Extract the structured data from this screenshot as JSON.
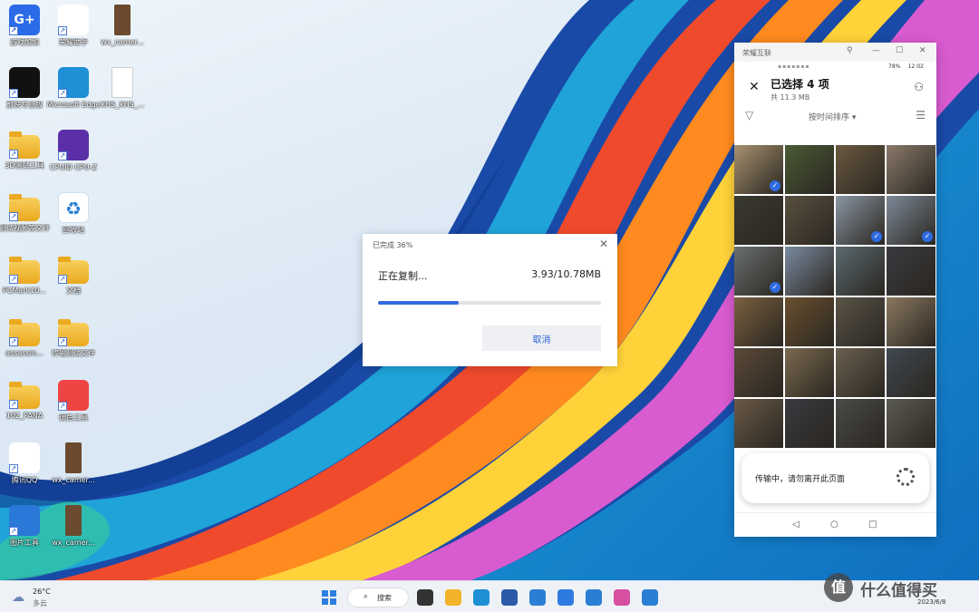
{
  "desktop": {
    "icons": [
      {
        "label": "游戏加加",
        "kind": "app",
        "color": "#2b6be8",
        "text": "G+"
      },
      {
        "label": "荣耀助手",
        "kind": "app",
        "color": "#ffffff",
        "text": ""
      },
      {
        "label": "wx_camer...",
        "kind": "image",
        "color": "#6b4a2f",
        "text": ""
      },
      {
        "label": "剪映专业版",
        "kind": "app",
        "color": "#111111",
        "text": ""
      },
      {
        "label": "Microsoft Edge",
        "kind": "app",
        "color": "#1f8fd6",
        "text": ""
      },
      {
        "label": "XHS_XHS_...",
        "kind": "file",
        "color": "#ffffff",
        "text": ""
      },
      {
        "label": "3D测试工具",
        "kind": "folder",
        "color": "#f0b830",
        "text": ""
      },
      {
        "label": "CPUID CPU-Z",
        "kind": "app",
        "color": "#5b2fa8",
        "text": ""
      },
      {
        "label": "",
        "kind": "none",
        "color": "",
        "text": ""
      },
      {
        "label": "测试视频等文件",
        "kind": "folder",
        "color": "#f0b830",
        "text": ""
      },
      {
        "label": "回收站",
        "kind": "recycle",
        "color": "#ffffff",
        "text": ""
      },
      {
        "label": "",
        "kind": "none",
        "color": "",
        "text": ""
      },
      {
        "label": "PCMark10...",
        "kind": "folder",
        "color": "#f0b830",
        "text": ""
      },
      {
        "label": "文档",
        "kind": "folder",
        "color": "#f0b830",
        "text": ""
      },
      {
        "label": "",
        "kind": "none",
        "color": "",
        "text": ""
      },
      {
        "label": "assassin...",
        "kind": "folder",
        "color": "#f0b830",
        "text": ""
      },
      {
        "label": "传输测试文件",
        "kind": "folder",
        "color": "#f0b830",
        "text": ""
      },
      {
        "label": "",
        "kind": "none",
        "color": "",
        "text": ""
      },
      {
        "label": "102_PANA",
        "kind": "folder",
        "color": "#f0b830",
        "text": ""
      },
      {
        "label": "调色工具",
        "kind": "app",
        "color": "#e44",
        "text": ""
      },
      {
        "label": "",
        "kind": "none",
        "color": "",
        "text": ""
      },
      {
        "label": "腾讯QQ",
        "kind": "app",
        "color": "#ffffff",
        "text": ""
      },
      {
        "label": "wx_camer...",
        "kind": "image",
        "color": "#6b4a2f",
        "text": ""
      },
      {
        "label": "",
        "kind": "none",
        "color": "",
        "text": ""
      },
      {
        "label": "图片工具",
        "kind": "app",
        "color": "#2a78d8",
        "text": ""
      },
      {
        "label": "wx_camer...",
        "kind": "image",
        "color": "#6b4a2f",
        "text": ""
      }
    ]
  },
  "copy_dialog": {
    "title": "已完成 36%",
    "close_glyph": "✕",
    "status": "正在复制...",
    "size": "3.93/10.78MB",
    "progress": 0.36,
    "cancel_label": "取消"
  },
  "phone_window": {
    "title": "荣耀互联",
    "status_time": "12:02",
    "battery": "78%",
    "header": {
      "close_glyph": "✕",
      "selected": "已选择 4 项",
      "total_size": "共 11.3 MB"
    },
    "sort_label": "按时间排序 ▾",
    "photos": [
      {
        "color": "#a89270",
        "checked": true
      },
      {
        "color": "#4a5a35",
        "checked": false
      },
      {
        "color": "#6a5a40",
        "checked": false
      },
      {
        "color": "#8a7a6a",
        "checked": false
      },
      {
        "color": "#3a3a30",
        "checked": false
      },
      {
        "color": "#5a5040",
        "checked": false
      },
      {
        "color": "#8a96a4",
        "checked": true
      },
      {
        "color": "#7e8a98",
        "checked": true
      },
      {
        "color": "#6a7070",
        "checked": true
      },
      {
        "color": "#7a8aa0",
        "checked": false
      },
      {
        "color": "#5a6a70",
        "checked": false
      },
      {
        "color": "#3a3a40",
        "checked": false
      },
      {
        "color": "#7a6040",
        "checked": false
      },
      {
        "color": "#6a5030",
        "checked": false
      },
      {
        "color": "#5a5448",
        "checked": false
      },
      {
        "color": "#8a7860",
        "checked": false
      },
      {
        "color": "#5a4a38",
        "checked": false
      },
      {
        "color": "#7a6a50",
        "checked": false
      },
      {
        "color": "#6a6050",
        "checked": false
      },
      {
        "color": "#404850",
        "checked": false
      },
      {
        "color": "#6a5a48",
        "checked": false
      },
      {
        "color": "#3a3a40",
        "checked": false
      },
      {
        "color": "#4a4a48",
        "checked": false
      },
      {
        "color": "#5a5a50",
        "checked": false
      }
    ],
    "toast_text": "传输中，请勿离开此页面"
  },
  "taskbar": {
    "weather_temp": "26°C",
    "weather_desc": "多云",
    "search_label": "搜索",
    "tray_date": "2023/6/8",
    "apps": [
      {
        "name": "task-view",
        "color": "#333333"
      },
      {
        "name": "file-explorer",
        "color": "#f2b32a"
      },
      {
        "name": "edge",
        "color": "#1f8fd6"
      },
      {
        "name": "store",
        "color": "#2b5ba8"
      },
      {
        "name": "remote-app-1",
        "color": "#2a7fd4"
      },
      {
        "name": "mail",
        "color": "#2f7ae0"
      },
      {
        "name": "remote-app-2",
        "color": "#2a7fd4"
      },
      {
        "name": "honor-assistant",
        "color": "#d64fa0"
      },
      {
        "name": "honor-connect",
        "color": "#2a7fd4"
      }
    ]
  },
  "watermark": {
    "logo_glyph": "值",
    "text": "什么值得买"
  }
}
